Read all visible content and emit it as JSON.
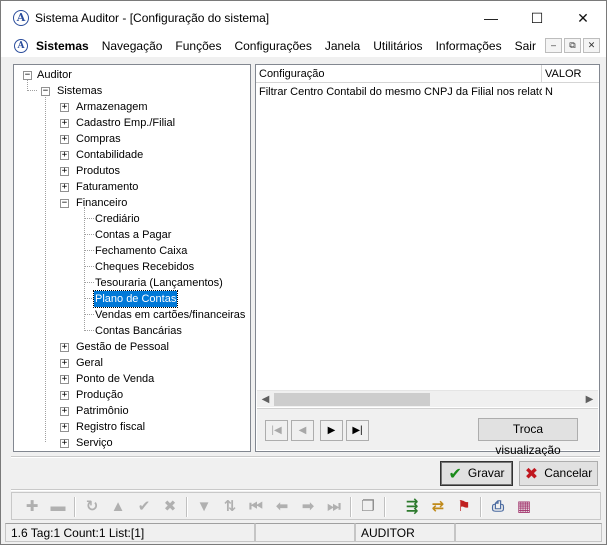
{
  "window": {
    "title": "Sistema Auditor - [Configuração do sistema]",
    "controls": {
      "minimize": "—",
      "maximize": "☐",
      "close": "✕"
    }
  },
  "menu": {
    "items": [
      "Sistemas",
      "Navegação",
      "Funções",
      "Configurações",
      "Janela",
      "Utilitários",
      "Informações",
      "Sair"
    ],
    "mdi_controls": [
      "–",
      "⧉",
      "✕"
    ]
  },
  "tree": {
    "root": "Auditor",
    "system": "Sistemas",
    "modules_before": [
      "Armazenagem",
      "Cadastro Emp./Filial",
      "Compras",
      "Contabilidade",
      "Produtos",
      "Faturamento"
    ],
    "expanded_module": "Financeiro",
    "financeiro_children": [
      "Crediário",
      "Contas a Pagar",
      "Fechamento Caixa",
      "Cheques Recebidos",
      "Tesouraria (Lançamentos)",
      "Plano de Contas",
      "Vendas em cartões/financeiras",
      "Contas Bancárias"
    ],
    "selected": "Plano de Contas",
    "modules_after": [
      "Gestão de Pessoal",
      "Geral",
      "Ponto de Venda",
      "Produção",
      "Patrimônio",
      "Registro fiscal",
      "Serviço"
    ]
  },
  "grid": {
    "columns": [
      "Configuração",
      "VALOR"
    ],
    "rows": [
      [
        "Filtrar Centro Contabil do mesmo CNPJ da Filial nos relatório",
        "N"
      ]
    ]
  },
  "navigator": {
    "buttons": [
      "|◀",
      "◀",
      "▶",
      "▶|"
    ],
    "toggle_view_label": "Troca visualização"
  },
  "actions": {
    "save_label": "Gravar",
    "cancel_label": "Cancelar"
  },
  "status": {
    "info": "1.6 Tag:1 Count:1 List:[1]",
    "user": "AUDITOR"
  },
  "colors": {
    "selection": "#0078d7",
    "save_icon": "#1a8a1a",
    "cancel_icon": "#c0171f",
    "brand": "#2b4d9c"
  }
}
